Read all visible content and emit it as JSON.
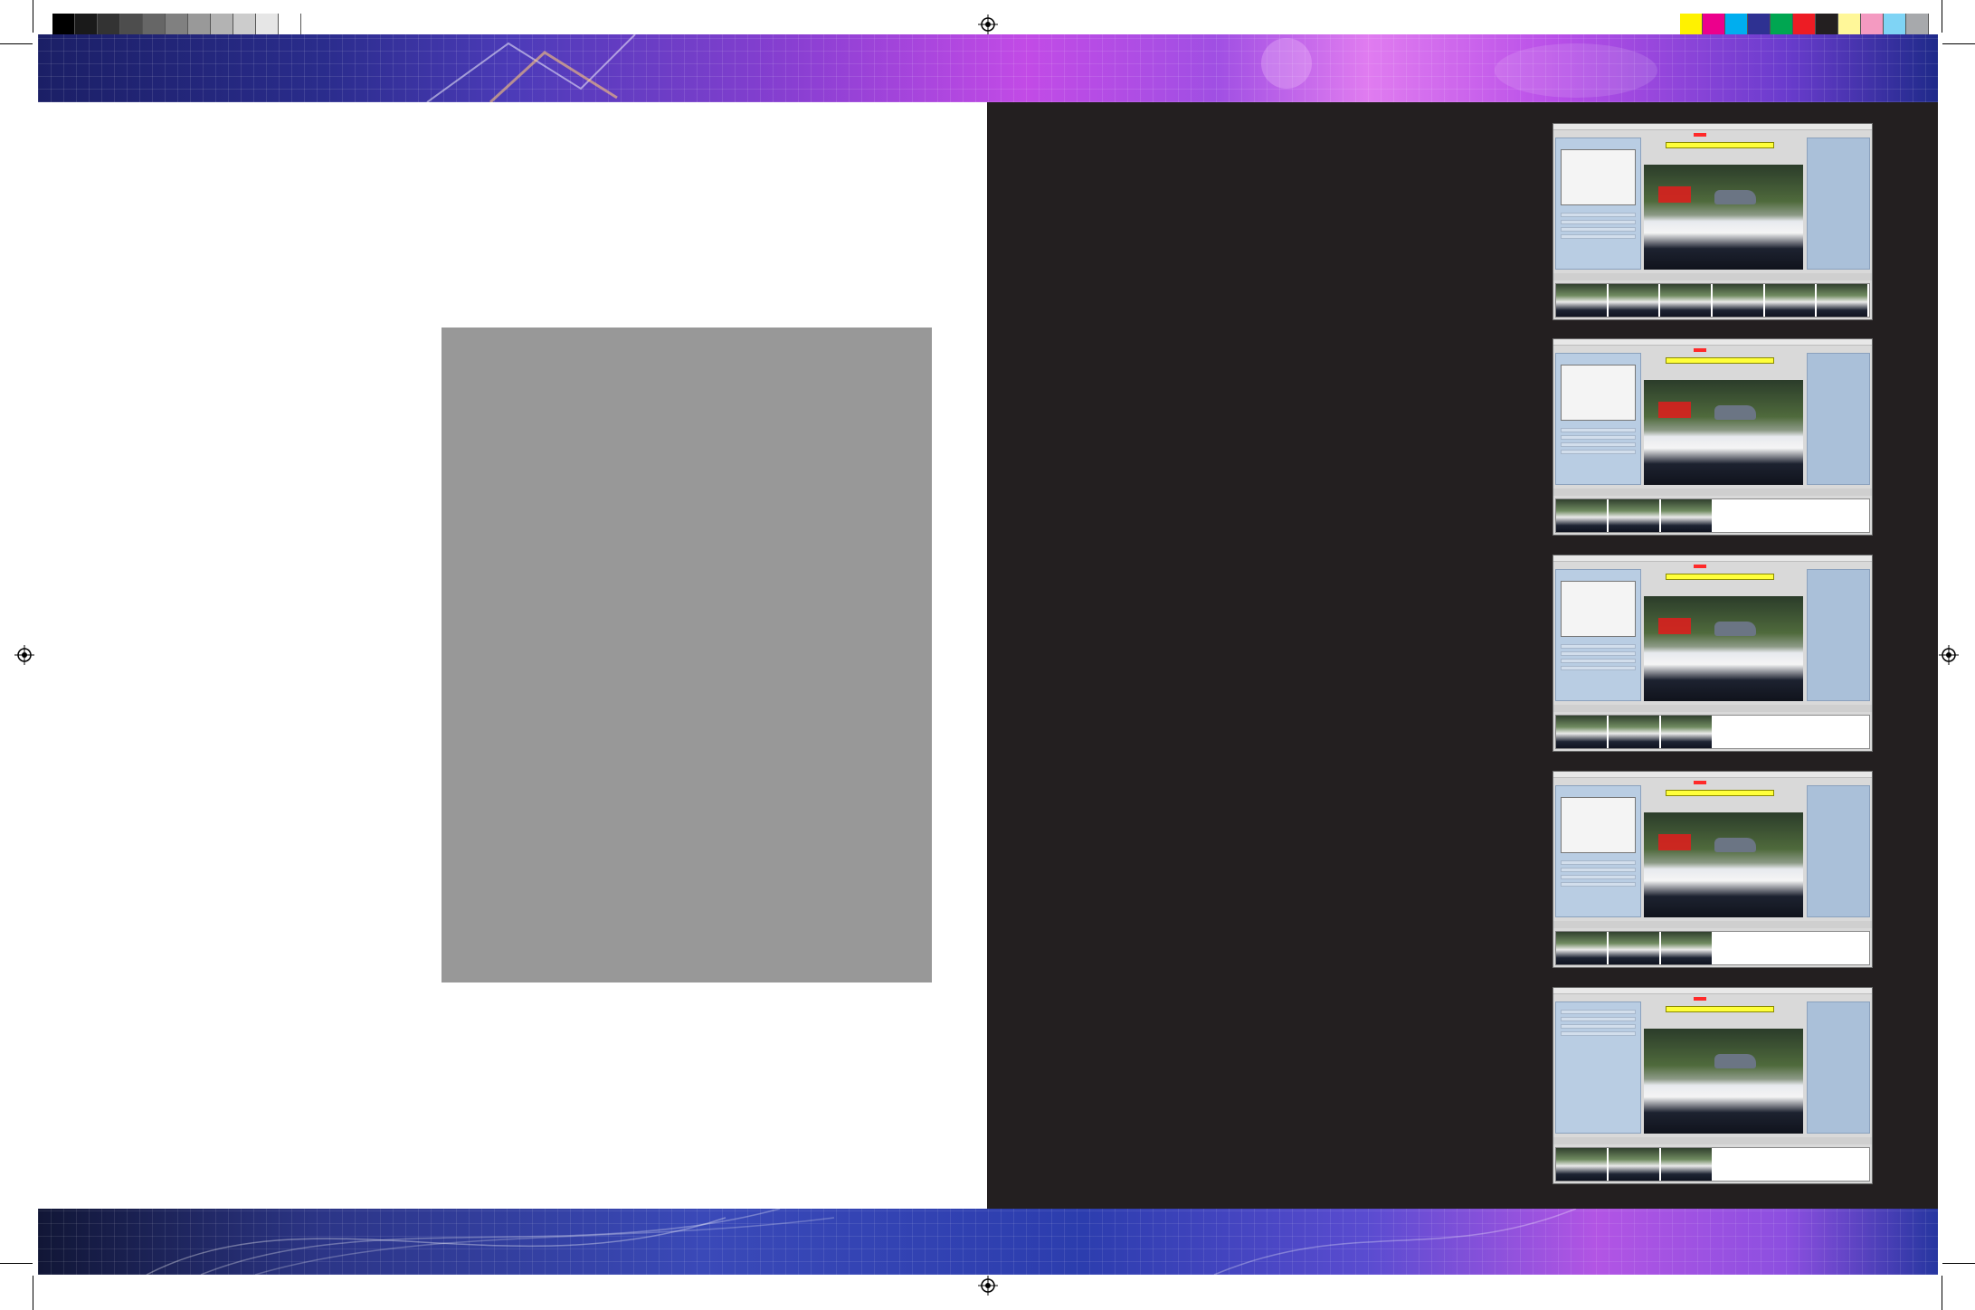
{
  "print_marks": {
    "grayscale_swatches": [
      "#000000",
      "#1a1a1a",
      "#333333",
      "#4d4d4d",
      "#666666",
      "#808080",
      "#999999",
      "#b3b3b3",
      "#cccccc",
      "#e6e6e6",
      "#ffffff"
    ],
    "color_swatches": [
      "#fff200",
      "#ec008c",
      "#00aeef",
      "#2e3192",
      "#00a651",
      "#ed1c24",
      "#231f20",
      "#fff799",
      "#f49ac1",
      "#7fd4f5",
      "#a7a9ac"
    ]
  },
  "layout_colors": {
    "dark_panel": "#231f20",
    "placeholder": "#989898"
  },
  "screenshots": [
    {
      "id": "screen-1",
      "has_red_region": true,
      "filmstrip_frames": 6
    },
    {
      "id": "screen-2",
      "has_red_region": true,
      "filmstrip_frames": 3
    },
    {
      "id": "screen-3",
      "has_red_region": true,
      "filmstrip_frames": 3
    },
    {
      "id": "screen-4",
      "has_red_region": true,
      "filmstrip_frames": 3
    },
    {
      "id": "screen-5",
      "has_red_region": false,
      "filmstrip_frames": 3
    }
  ]
}
